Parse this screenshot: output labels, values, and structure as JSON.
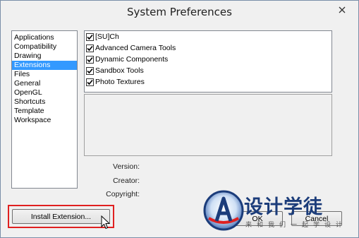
{
  "window": {
    "title": "System Preferences"
  },
  "categories": [
    {
      "label": "Applications",
      "selected": false
    },
    {
      "label": "Compatibility",
      "selected": false
    },
    {
      "label": "Drawing",
      "selected": false
    },
    {
      "label": "Extensions",
      "selected": true
    },
    {
      "label": "Files",
      "selected": false
    },
    {
      "label": "General",
      "selected": false
    },
    {
      "label": "OpenGL",
      "selected": false
    },
    {
      "label": "Shortcuts",
      "selected": false
    },
    {
      "label": "Template",
      "selected": false
    },
    {
      "label": "Workspace",
      "selected": false
    }
  ],
  "extensions": [
    {
      "label": "[SU]Ch",
      "checked": true
    },
    {
      "label": "Advanced Camera Tools",
      "checked": true
    },
    {
      "label": "Dynamic Components",
      "checked": true
    },
    {
      "label": "Sandbox Tools",
      "checked": true
    },
    {
      "label": "Photo Textures",
      "checked": true
    }
  ],
  "details": {
    "version_label": "Version:",
    "creator_label": "Creator:",
    "copyright_label": "Copyright:"
  },
  "buttons": {
    "install_label": "Install Extension...",
    "ok_label": "OK",
    "cancel_label": "Cancel"
  },
  "watermark": {
    "title": "设计学徒",
    "subtitle": "来和我们一起学设计"
  },
  "colors": {
    "selection": "#3399ff",
    "highlight_border": "#e02020",
    "watermark_blue": "#1b3c7a"
  }
}
